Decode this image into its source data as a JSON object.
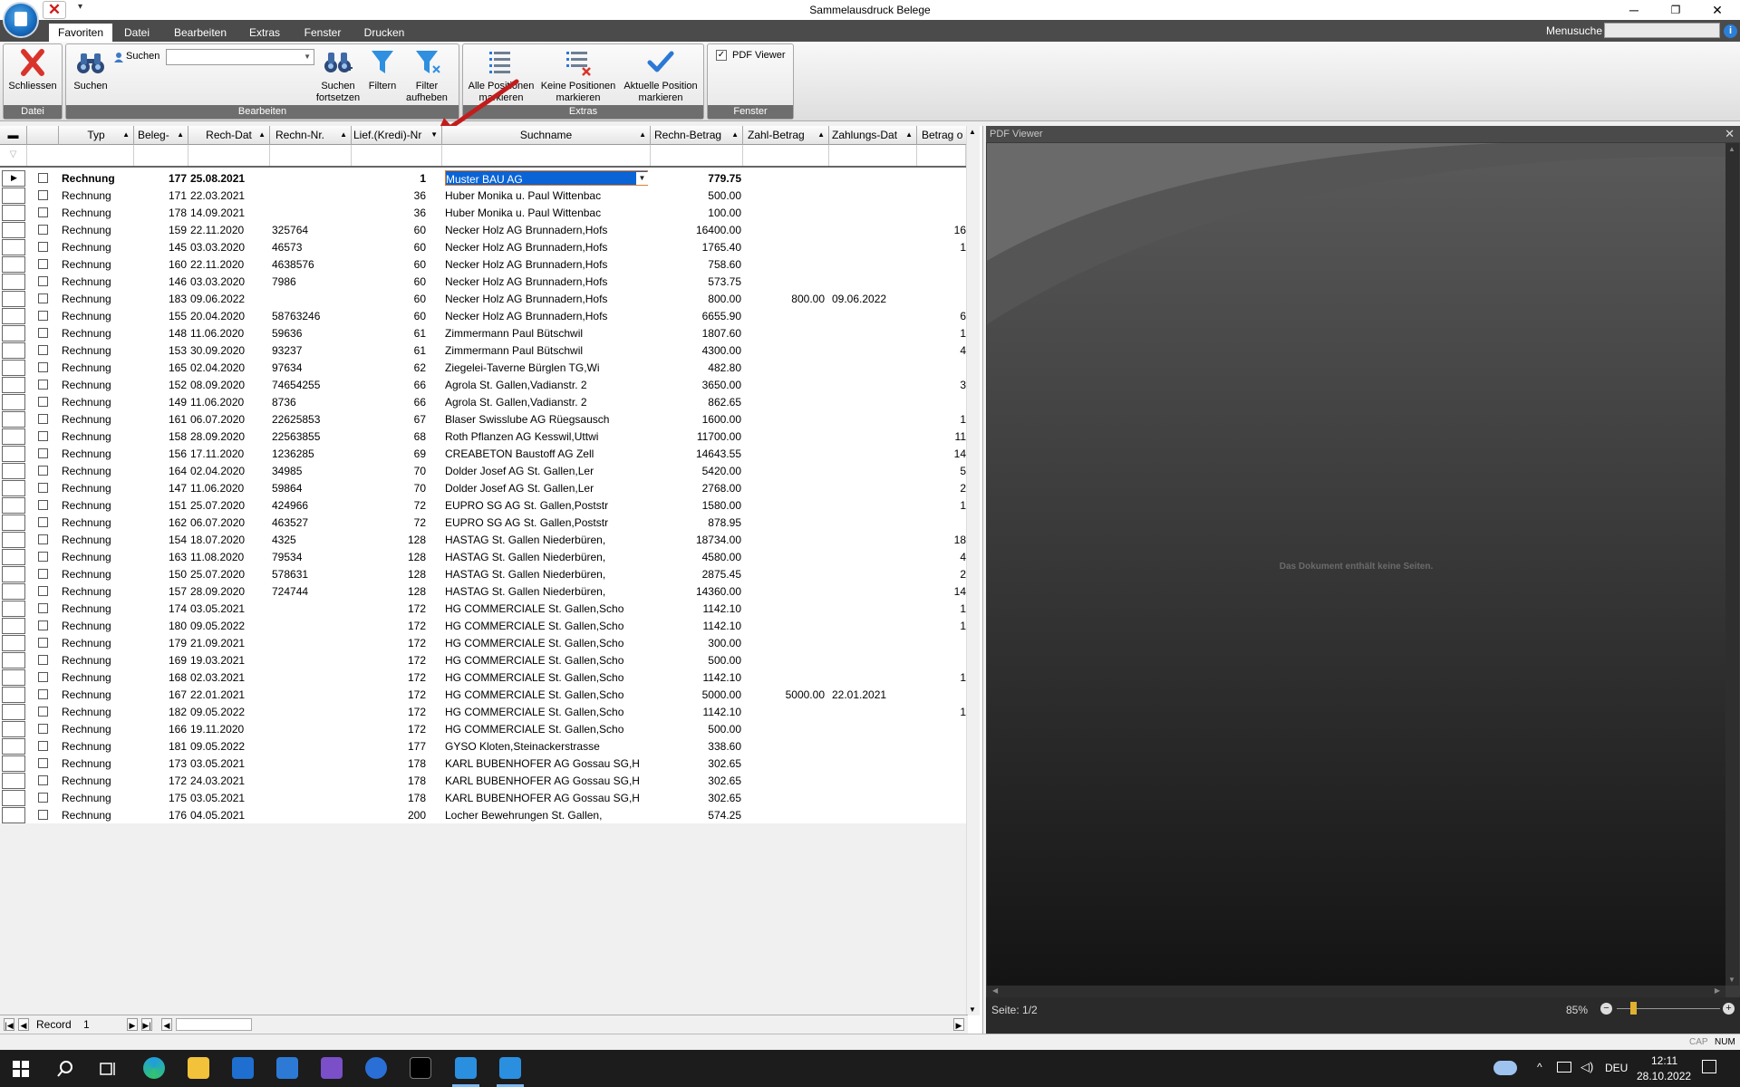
{
  "window": {
    "title": "Sammelausdruck Belege",
    "minimize": "─",
    "restore": "❐",
    "close": "✕"
  },
  "quick_access": {
    "close_glyph": "✕",
    "more_glyph": "▾"
  },
  "menu": {
    "tabs": [
      "Favoriten",
      "Datei",
      "Bearbeiten",
      "Extras",
      "Fenster",
      "Drucken"
    ],
    "active": "Favoriten",
    "menusuche_label": "Menusuche",
    "info_glyph": "i"
  },
  "ribbon": {
    "groups": {
      "datei": "Datei",
      "bearbeiten": "Bearbeiten",
      "extras": "Extras",
      "fenster": "Fenster"
    },
    "buttons": {
      "schliessen": "Schliessen",
      "suchen": "Suchen",
      "suchen_label": "Suchen",
      "suchen_fortsetzen_1": "Suchen",
      "suchen_fortsetzen_2": "fortsetzen",
      "filtern": "Filtern",
      "filter_aufheben_1": "Filter",
      "filter_aufheben_2": "aufheben",
      "alle_1": "Alle Positionen",
      "alle_2": "markieren",
      "keine_1": "Keine Positionen",
      "keine_2": "markieren",
      "aktuelle_1": "Aktuelle Position",
      "aktuelle_2": "markieren",
      "pdf_viewer": "PDF Viewer",
      "pdf_viewer_checked": "✓"
    },
    "colors": {
      "close_red": "#d9342b",
      "filter_blue": "#2f8fe0",
      "check_blue": "#2b78d6"
    }
  },
  "grid": {
    "columns": {
      "typ": "Typ",
      "beleg": "Beleg-",
      "rechdat": "Rech-Dat",
      "rechnnr": "Rechn-Nr.",
      "lief": "Lief.(Kredi)-Nr",
      "suchname": "Suchname",
      "rechnbetrag": "Rechn-Betrag",
      "zahlbetrag": "Zahl-Betrag",
      "zahlungsdat": "Zahlungs-Dat",
      "betrago": "Betrag o"
    },
    "rows": [
      {
        "typ": "Rechnung",
        "beleg": "177",
        "dat": "25.08.2021",
        "rnr": "",
        "lief": "1",
        "name": "Muster BAU AG",
        "betrag": "779.75",
        "zahl": "",
        "zdat": "",
        "bo": ""
      },
      {
        "typ": "Rechnung",
        "beleg": "171",
        "dat": "22.03.2021",
        "rnr": "",
        "lief": "36",
        "name": "Huber Monika u. Paul Wittenbac",
        "betrag": "500.00",
        "zahl": "",
        "zdat": "",
        "bo": ""
      },
      {
        "typ": "Rechnung",
        "beleg": "178",
        "dat": "14.09.2021",
        "rnr": "",
        "lief": "36",
        "name": "Huber Monika u. Paul Wittenbac",
        "betrag": "100.00",
        "zahl": "",
        "zdat": "",
        "bo": ""
      },
      {
        "typ": "Rechnung",
        "beleg": "159",
        "dat": "22.11.2020",
        "rnr": "325764",
        "lief": "60",
        "name": "Necker Holz AG Brunnadern,Hofs",
        "betrag": "16400.00",
        "zahl": "",
        "zdat": "",
        "bo": "16"
      },
      {
        "typ": "Rechnung",
        "beleg": "145",
        "dat": "03.03.2020",
        "rnr": "46573",
        "lief": "60",
        "name": "Necker Holz AG Brunnadern,Hofs",
        "betrag": "1765.40",
        "zahl": "",
        "zdat": "",
        "bo": "1"
      },
      {
        "typ": "Rechnung",
        "beleg": "160",
        "dat": "22.11.2020",
        "rnr": "4638576",
        "lief": "60",
        "name": "Necker Holz AG Brunnadern,Hofs",
        "betrag": "758.60",
        "zahl": "",
        "zdat": "",
        "bo": ""
      },
      {
        "typ": "Rechnung",
        "beleg": "146",
        "dat": "03.03.2020",
        "rnr": "7986",
        "lief": "60",
        "name": "Necker Holz AG Brunnadern,Hofs",
        "betrag": "573.75",
        "zahl": "",
        "zdat": "",
        "bo": ""
      },
      {
        "typ": "Rechnung",
        "beleg": "183",
        "dat": "09.06.2022",
        "rnr": "",
        "lief": "60",
        "name": "Necker Holz AG Brunnadern,Hofs",
        "betrag": "800.00",
        "zahl": "800.00",
        "zdat": "09.06.2022",
        "bo": ""
      },
      {
        "typ": "Rechnung",
        "beleg": "155",
        "dat": "20.04.2020",
        "rnr": "58763246",
        "lief": "60",
        "name": "Necker Holz AG Brunnadern,Hofs",
        "betrag": "6655.90",
        "zahl": "",
        "zdat": "",
        "bo": "6"
      },
      {
        "typ": "Rechnung",
        "beleg": "148",
        "dat": "11.06.2020",
        "rnr": "59636",
        "lief": "61",
        "name": "Zimmermann Paul Bütschwil",
        "betrag": "1807.60",
        "zahl": "",
        "zdat": "",
        "bo": "1"
      },
      {
        "typ": "Rechnung",
        "beleg": "153",
        "dat": "30.09.2020",
        "rnr": "93237",
        "lief": "61",
        "name": "Zimmermann Paul Bütschwil",
        "betrag": "4300.00",
        "zahl": "",
        "zdat": "",
        "bo": "4"
      },
      {
        "typ": "Rechnung",
        "beleg": "165",
        "dat": "02.04.2020",
        "rnr": "97634",
        "lief": "62",
        "name": "Ziegelei-Taverne Bürglen TG,Wi",
        "betrag": "482.80",
        "zahl": "",
        "zdat": "",
        "bo": ""
      },
      {
        "typ": "Rechnung",
        "beleg": "152",
        "dat": "08.09.2020",
        "rnr": "74654255",
        "lief": "66",
        "name": "Agrola St. Gallen,Vadianstr. 2",
        "betrag": "3650.00",
        "zahl": "",
        "zdat": "",
        "bo": "3"
      },
      {
        "typ": "Rechnung",
        "beleg": "149",
        "dat": "11.06.2020",
        "rnr": "8736",
        "lief": "66",
        "name": "Agrola St. Gallen,Vadianstr. 2",
        "betrag": "862.65",
        "zahl": "",
        "zdat": "",
        "bo": ""
      },
      {
        "typ": "Rechnung",
        "beleg": "161",
        "dat": "06.07.2020",
        "rnr": "22625853",
        "lief": "67",
        "name": "Blaser Swisslube AG Rüegsausch",
        "betrag": "1600.00",
        "zahl": "",
        "zdat": "",
        "bo": "1"
      },
      {
        "typ": "Rechnung",
        "beleg": "158",
        "dat": "28.09.2020",
        "rnr": "22563855",
        "lief": "68",
        "name": "Roth Pflanzen AG Kesswil,Uttwi",
        "betrag": "11700.00",
        "zahl": "",
        "zdat": "",
        "bo": "11"
      },
      {
        "typ": "Rechnung",
        "beleg": "156",
        "dat": "17.11.2020",
        "rnr": "1236285",
        "lief": "69",
        "name": "CREABETON Baustoff AG Zell",
        "betrag": "14643.55",
        "zahl": "",
        "zdat": "",
        "bo": "14"
      },
      {
        "typ": "Rechnung",
        "beleg": "164",
        "dat": "02.04.2020",
        "rnr": "34985",
        "lief": "70",
        "name": "Dolder Josef AG St. Gallen,Ler",
        "betrag": "5420.00",
        "zahl": "",
        "zdat": "",
        "bo": "5"
      },
      {
        "typ": "Rechnung",
        "beleg": "147",
        "dat": "11.06.2020",
        "rnr": "59864",
        "lief": "70",
        "name": "Dolder Josef AG St. Gallen,Ler",
        "betrag": "2768.00",
        "zahl": "",
        "zdat": "",
        "bo": "2"
      },
      {
        "typ": "Rechnung",
        "beleg": "151",
        "dat": "25.07.2020",
        "rnr": "424966",
        "lief": "72",
        "name": "EUPRO SG AG St. Gallen,Poststr",
        "betrag": "1580.00",
        "zahl": "",
        "zdat": "",
        "bo": "1"
      },
      {
        "typ": "Rechnung",
        "beleg": "162",
        "dat": "06.07.2020",
        "rnr": "463527",
        "lief": "72",
        "name": "EUPRO SG AG St. Gallen,Poststr",
        "betrag": "878.95",
        "zahl": "",
        "zdat": "",
        "bo": ""
      },
      {
        "typ": "Rechnung",
        "beleg": "154",
        "dat": "18.07.2020",
        "rnr": "4325",
        "lief": "128",
        "name": "HASTAG St. Gallen Niederbüren,",
        "betrag": "18734.00",
        "zahl": "",
        "zdat": "",
        "bo": "18"
      },
      {
        "typ": "Rechnung",
        "beleg": "163",
        "dat": "11.08.2020",
        "rnr": "79534",
        "lief": "128",
        "name": "HASTAG St. Gallen Niederbüren,",
        "betrag": "4580.00",
        "zahl": "",
        "zdat": "",
        "bo": "4"
      },
      {
        "typ": "Rechnung",
        "beleg": "150",
        "dat": "25.07.2020",
        "rnr": "578631",
        "lief": "128",
        "name": "HASTAG St. Gallen Niederbüren,",
        "betrag": "2875.45",
        "zahl": "",
        "zdat": "",
        "bo": "2"
      },
      {
        "typ": "Rechnung",
        "beleg": "157",
        "dat": "28.09.2020",
        "rnr": "724744",
        "lief": "128",
        "name": "HASTAG St. Gallen Niederbüren,",
        "betrag": "14360.00",
        "zahl": "",
        "zdat": "",
        "bo": "14"
      },
      {
        "typ": "Rechnung",
        "beleg": "174",
        "dat": "03.05.2021",
        "rnr": "",
        "lief": "172",
        "name": "HG COMMERCIALE St. Gallen,Scho",
        "betrag": "1142.10",
        "zahl": "",
        "zdat": "",
        "bo": "1"
      },
      {
        "typ": "Rechnung",
        "beleg": "180",
        "dat": "09.05.2022",
        "rnr": "",
        "lief": "172",
        "name": "HG COMMERCIALE St. Gallen,Scho",
        "betrag": "1142.10",
        "zahl": "",
        "zdat": "",
        "bo": "1"
      },
      {
        "typ": "Rechnung",
        "beleg": "179",
        "dat": "21.09.2021",
        "rnr": "",
        "lief": "172",
        "name": "HG COMMERCIALE St. Gallen,Scho",
        "betrag": "300.00",
        "zahl": "",
        "zdat": "",
        "bo": ""
      },
      {
        "typ": "Rechnung",
        "beleg": "169",
        "dat": "19.03.2021",
        "rnr": "",
        "lief": "172",
        "name": "HG COMMERCIALE St. Gallen,Scho",
        "betrag": "500.00",
        "zahl": "",
        "zdat": "",
        "bo": ""
      },
      {
        "typ": "Rechnung",
        "beleg": "168",
        "dat": "02.03.2021",
        "rnr": "",
        "lief": "172",
        "name": "HG COMMERCIALE St. Gallen,Scho",
        "betrag": "1142.10",
        "zahl": "",
        "zdat": "",
        "bo": "1"
      },
      {
        "typ": "Rechnung",
        "beleg": "167",
        "dat": "22.01.2021",
        "rnr": "",
        "lief": "172",
        "name": "HG COMMERCIALE St. Gallen,Scho",
        "betrag": "5000.00",
        "zahl": "5000.00",
        "zdat": "22.01.2021",
        "bo": ""
      },
      {
        "typ": "Rechnung",
        "beleg": "182",
        "dat": "09.05.2022",
        "rnr": "",
        "lief": "172",
        "name": "HG COMMERCIALE St. Gallen,Scho",
        "betrag": "1142.10",
        "zahl": "",
        "zdat": "",
        "bo": "1"
      },
      {
        "typ": "Rechnung",
        "beleg": "166",
        "dat": "19.11.2020",
        "rnr": "",
        "lief": "172",
        "name": "HG COMMERCIALE St. Gallen,Scho",
        "betrag": "500.00",
        "zahl": "",
        "zdat": "",
        "bo": ""
      },
      {
        "typ": "Rechnung",
        "beleg": "181",
        "dat": "09.05.2022",
        "rnr": "",
        "lief": "177",
        "name": "GYSO Kloten,Steinackerstrasse",
        "betrag": "338.60",
        "zahl": "",
        "zdat": "",
        "bo": ""
      },
      {
        "typ": "Rechnung",
        "beleg": "173",
        "dat": "03.05.2021",
        "rnr": "",
        "lief": "178",
        "name": "KARL BUBENHOFER AG Gossau SG,H",
        "betrag": "302.65",
        "zahl": "",
        "zdat": "",
        "bo": ""
      },
      {
        "typ": "Rechnung",
        "beleg": "172",
        "dat": "24.03.2021",
        "rnr": "",
        "lief": "178",
        "name": "KARL BUBENHOFER AG Gossau SG,H",
        "betrag": "302.65",
        "zahl": "",
        "zdat": "",
        "bo": ""
      },
      {
        "typ": "Rechnung",
        "beleg": "175",
        "dat": "03.05.2021",
        "rnr": "",
        "lief": "178",
        "name": "KARL BUBENHOFER AG Gossau SG,H",
        "betrag": "302.65",
        "zahl": "",
        "zdat": "",
        "bo": ""
      },
      {
        "typ": "Rechnung",
        "beleg": "176",
        "dat": "04.05.2021",
        "rnr": "",
        "lief": "200",
        "name": "Locher Bewehrungen St. Gallen,",
        "betrag": "574.25",
        "zahl": "",
        "zdat": "",
        "bo": ""
      }
    ],
    "selected_row": 0,
    "selection_color": "#0a64d6",
    "navigator": {
      "record_label": "Record",
      "record_value": "1"
    }
  },
  "pdf": {
    "title": "PDF Viewer",
    "empty_message": "Das Dokument enthält keine Seiten.",
    "page_label": "Seite: 1/2",
    "zoom": "85%"
  },
  "status": {
    "cap": "CAP",
    "num": "NUM"
  },
  "taskbar": {
    "lang": "DEU",
    "time": "12:11",
    "date": "28.10.2022"
  }
}
